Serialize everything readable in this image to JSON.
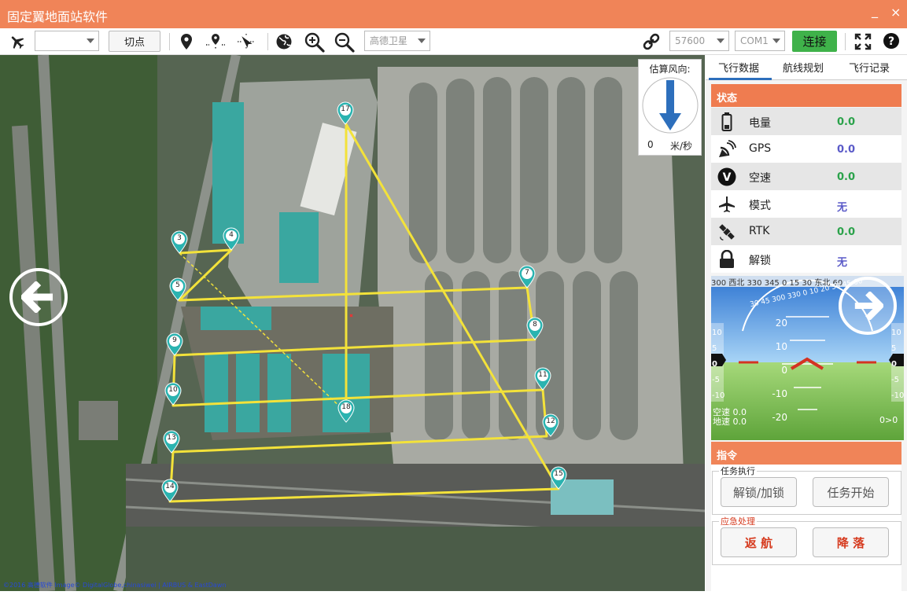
{
  "window": {
    "title": "固定翼地面站软件",
    "minimize": "_",
    "close": "×"
  },
  "toolbar": {
    "vehicle_select": "",
    "cut_point_label": "切点",
    "map_source": "高德卫星",
    "baud_rate": "57600",
    "port": "COM1",
    "connect_label": "连接",
    "icons": [
      "plane-icon",
      "location-pin-icon",
      "waypoint-add-icon",
      "drone-target-icon",
      "globe-icon",
      "zoom-in-icon",
      "zoom-out-icon",
      "link-icon",
      "fullscreen-icon",
      "help-icon"
    ],
    "accent": "#3fb24a"
  },
  "map": {
    "copyright": "©2016 高德软件 Image© DigitalGlobe,chinasiwei | AIRBUS & EastDawn",
    "route_color": "#f3e23a",
    "marker_color": "#2ab3b0",
    "waypoints": [
      "3",
      "4",
      "5",
      "7",
      "8",
      "9",
      "10",
      "11",
      "12",
      "13",
      "14",
      "15",
      "17",
      "18"
    ],
    "wind": {
      "title": "估算风向:",
      "speed": "0",
      "unit": "米/秒"
    }
  },
  "panel": {
    "tabs": [
      "飞行数据",
      "航线规划",
      "飞行记录"
    ],
    "active_tab": 0,
    "status": {
      "header": "状态",
      "rows": [
        {
          "label": "电量",
          "value": "0.0",
          "icon": "battery-icon"
        },
        {
          "label": "GPS",
          "value": "0.0",
          "icon": "satellite-dish-icon"
        },
        {
          "label": "空速",
          "value": "0.0",
          "icon": "speed-v-icon"
        },
        {
          "label": "模式",
          "value": "无",
          "icon": "plane-mode-icon"
        },
        {
          "label": "RTK",
          "value": "0.0",
          "icon": "satellite-icon"
        },
        {
          "label": "解锁",
          "value": "无",
          "icon": "lock-icon"
        }
      ]
    },
    "hud": {
      "heading_tape": "300  西北  330  345   0   15   30  东北  60",
      "roll_scale": "30 45  300 330 0 10 20 30 45 60",
      "pitch_labels": [
        "20",
        "10",
        "0",
        "-10",
        "-20"
      ],
      "side_left": [
        "0",
        "10",
        "5",
        "0",
        "-5",
        "-10"
      ],
      "side_right": [
        "10",
        "5",
        "0",
        "-5",
        "-10"
      ],
      "airspeed": "空速 0.0",
      "groundspeed": "地速 0.0",
      "misc": "0>0"
    },
    "commands": {
      "header": "指令",
      "mission_group": "任务执行",
      "arm_label": "解锁/加锁",
      "start_label": "任务开始",
      "emergency_group": "应急处理",
      "rtl_label": "返 航",
      "land_label": "降 落"
    }
  }
}
